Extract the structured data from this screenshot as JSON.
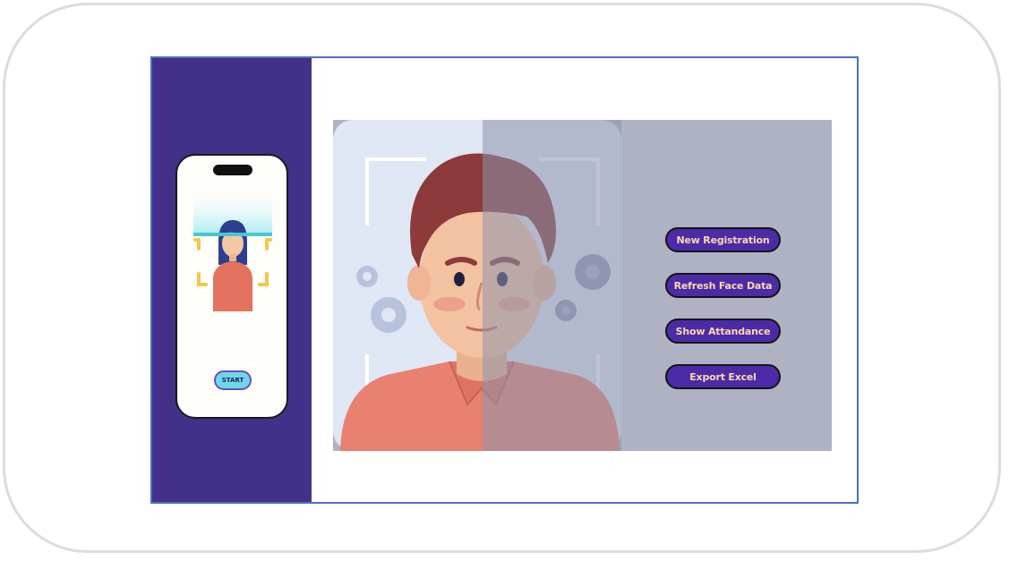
{
  "phone": {
    "start_label": "START"
  },
  "actions": [
    {
      "label": "New Registration"
    },
    {
      "label": "Refresh Face Data"
    },
    {
      "label": "Show Attandance"
    },
    {
      "label": "Export Excel"
    }
  ],
  "colors": {
    "sidebar": "#433189",
    "button_fill": "#4b2ba8",
    "button_text": "#ffd9a8",
    "app_border": "#4a71c4",
    "hero_background": "#aeb2c2"
  },
  "icons": [
    "face-scan-illustration",
    "gear-icon",
    "scan-frame-icon",
    "phone-notch-icon"
  ]
}
